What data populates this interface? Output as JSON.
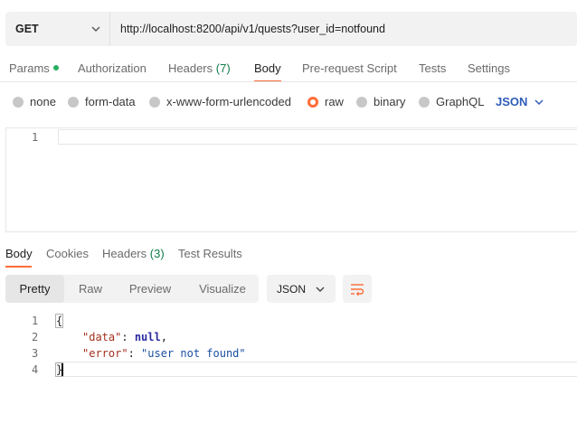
{
  "request": {
    "method": "GET",
    "url": "http://localhost:8200/api/v1/quests?user_id=notfound"
  },
  "request_tabs": [
    {
      "label": "Params",
      "indicator": "green-dot"
    },
    {
      "label": "Authorization"
    },
    {
      "label": "Headers",
      "count": "(7)"
    },
    {
      "label": "Body",
      "active": true
    },
    {
      "label": "Pre-request Script"
    },
    {
      "label": "Tests"
    },
    {
      "label": "Settings"
    }
  ],
  "body_types": [
    {
      "label": "none"
    },
    {
      "label": "form-data"
    },
    {
      "label": "x-www-form-urlencoded"
    },
    {
      "label": "raw",
      "selected": true
    },
    {
      "label": "binary"
    },
    {
      "label": "GraphQL"
    }
  ],
  "body_language": "JSON",
  "editor": {
    "line_numbers": [
      "1"
    ],
    "content": ""
  },
  "response_tabs": [
    {
      "label": "Body",
      "active": true
    },
    {
      "label": "Cookies"
    },
    {
      "label": "Headers",
      "count": "(3)"
    },
    {
      "label": "Test Results"
    }
  ],
  "view_modes": [
    {
      "label": "Pretty",
      "active": true
    },
    {
      "label": "Raw"
    },
    {
      "label": "Preview"
    },
    {
      "label": "Visualize"
    }
  ],
  "response_format": "JSON",
  "response_lines": [
    {
      "num": "1",
      "text": "{"
    },
    {
      "num": "2",
      "key": "\"data\"",
      "sep": ": ",
      "value": "null",
      "tail": ","
    },
    {
      "num": "3",
      "key": "\"error\"",
      "sep": ": ",
      "value": "\"user not found\"",
      "tail": ""
    },
    {
      "num": "4",
      "text": "}"
    }
  ],
  "colors": {
    "accent": "#ff6c37",
    "link_blue": "#2e5cb8",
    "count_green": "#0f7d48",
    "status_dot": "#27ae60"
  },
  "icons": [
    "chevron-down-icon",
    "wrap-lines-icon"
  ]
}
